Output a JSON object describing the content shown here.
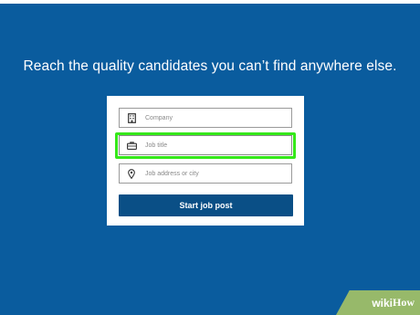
{
  "page": {
    "headline": "Reach the quality candidates you can’t find anywhere else."
  },
  "form": {
    "company": {
      "placeholder": "Company",
      "icon": "building-icon"
    },
    "job_title": {
      "placeholder": "Job title",
      "icon": "briefcase-icon"
    },
    "job_address": {
      "placeholder": "Job address or city",
      "icon": "location-pin-icon"
    },
    "submit_label": "Start job post"
  },
  "watermark": {
    "part1": "wiki",
    "part2": "How"
  },
  "colors": {
    "background": "#0a5c9e",
    "button": "#0a4f86",
    "highlight": "#35e81a",
    "watermark": "#97b96a"
  }
}
